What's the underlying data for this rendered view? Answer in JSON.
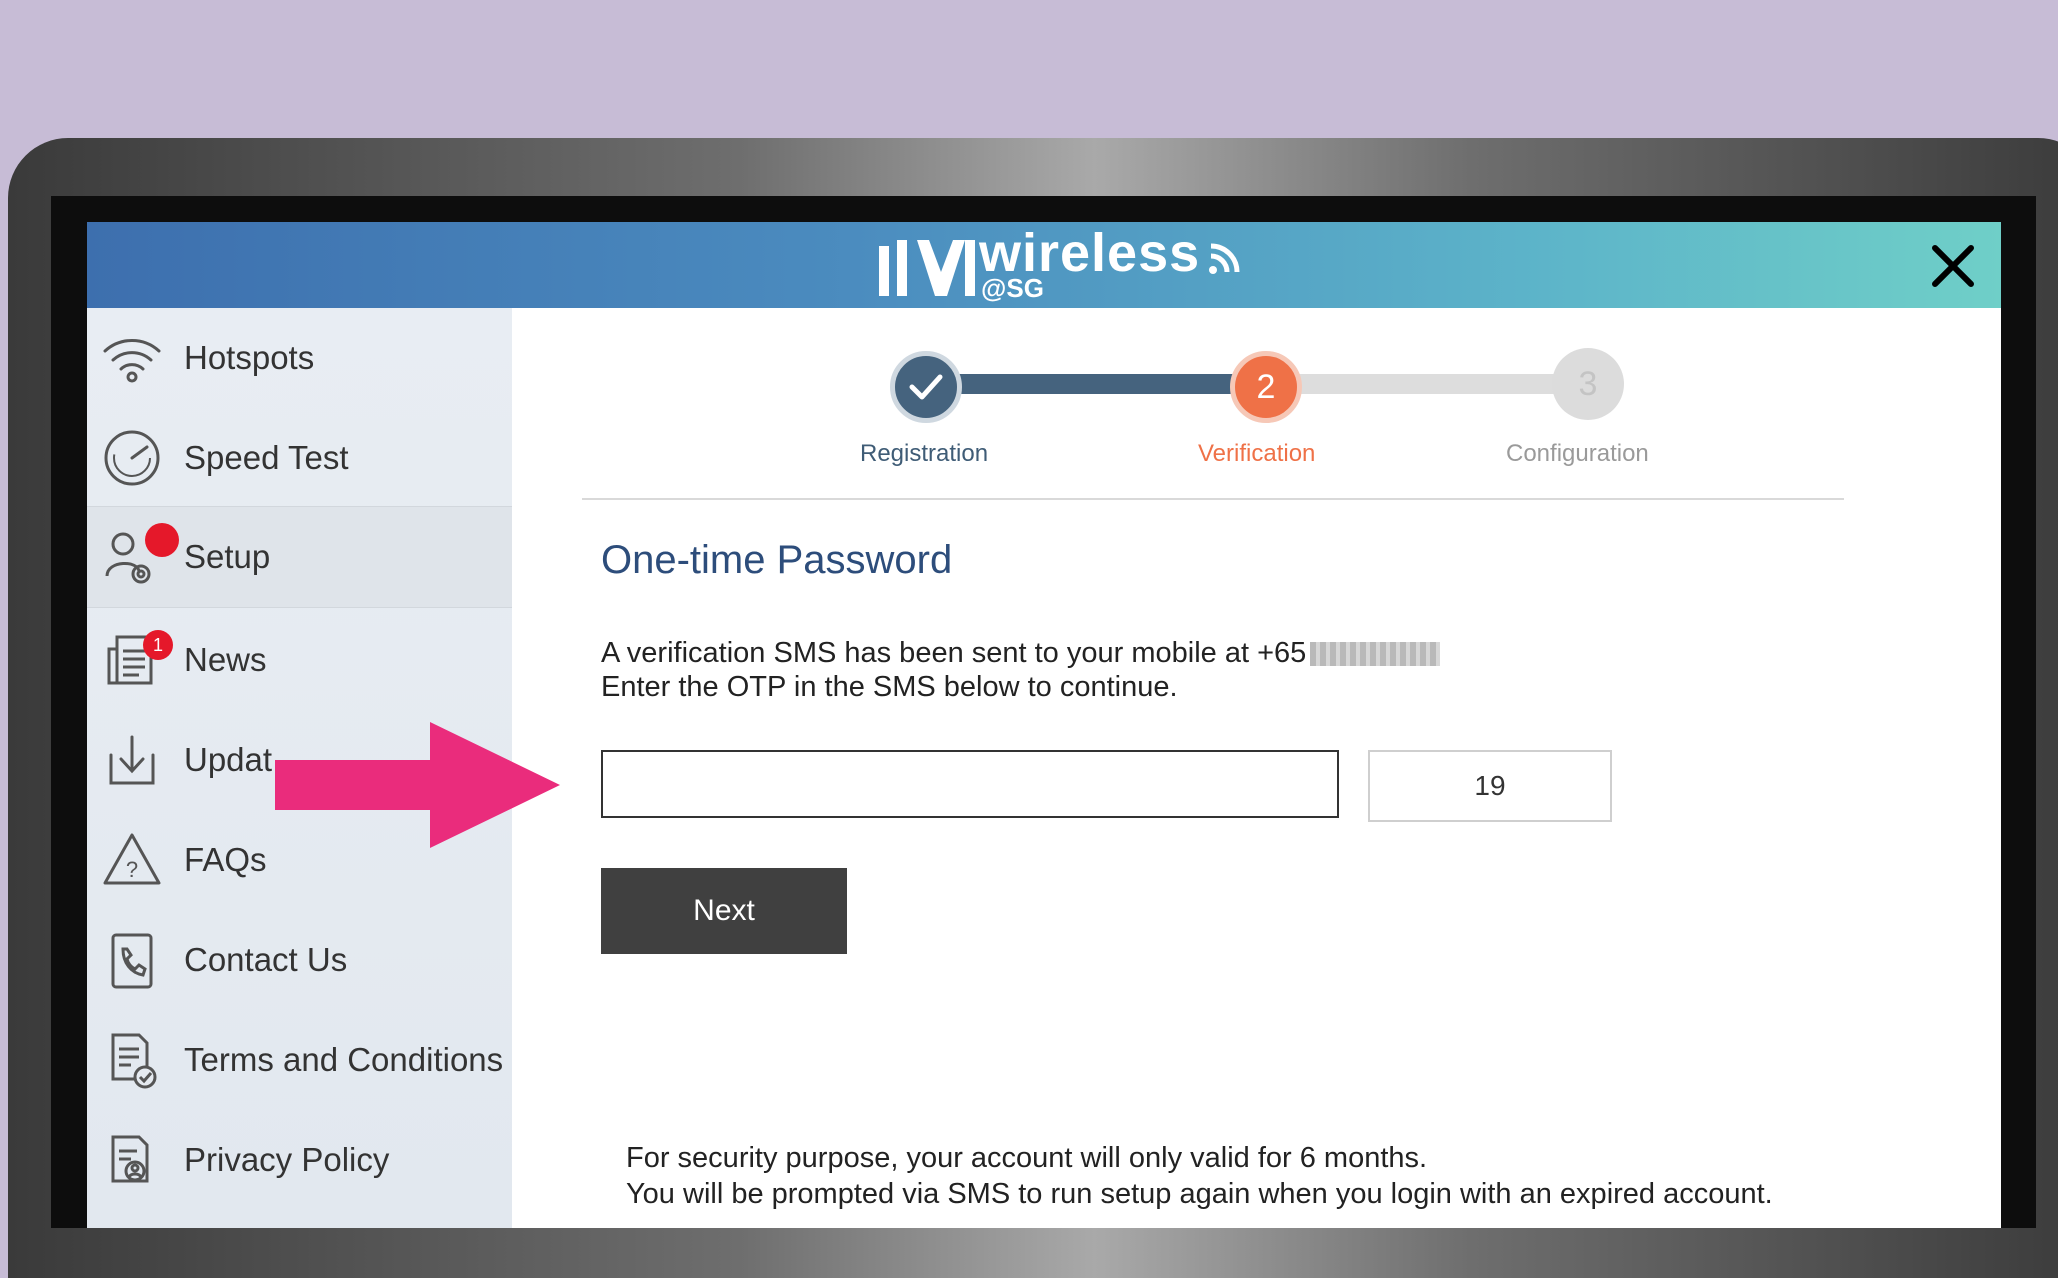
{
  "header": {
    "brand": "wireless",
    "brand_sub": "@SG"
  },
  "sidebar": {
    "items": [
      {
        "label": "Hotspots",
        "icon": "wifi-icon"
      },
      {
        "label": "Speed Test",
        "icon": "speedometer-icon"
      },
      {
        "label": "Setup",
        "icon": "user-settings-icon",
        "active": true,
        "badge": ""
      },
      {
        "label": "News",
        "icon": "news-icon",
        "badge": "1"
      },
      {
        "label": "Updat",
        "icon": "download-icon"
      },
      {
        "label": "FAQs",
        "icon": "warning-question-icon"
      },
      {
        "label": "Contact Us",
        "icon": "phone-icon"
      },
      {
        "label": "Terms and Conditions",
        "icon": "document-check-icon"
      },
      {
        "label": "Privacy Policy",
        "icon": "privacy-document-icon"
      }
    ]
  },
  "stepper": {
    "steps": [
      {
        "number": "1",
        "label": "Registration",
        "state": "done"
      },
      {
        "number": "2",
        "label": "Verification",
        "state": "current"
      },
      {
        "number": "3",
        "label": "Configuration",
        "state": "pending"
      }
    ]
  },
  "otp": {
    "title": "One-time Password",
    "line1": "A verification SMS has been sent to your mobile at +65",
    "line2": "Enter the OTP in the SMS below to continue.",
    "input_value": "",
    "timer": "19",
    "next_label": "Next"
  },
  "security": {
    "line1": "For security purpose, your account will only valid for 6 months.",
    "line2": "You will be prompted via SMS to run setup again when you login with an expired account."
  },
  "colors": {
    "accent_done": "#45637e",
    "accent_current": "#ef7147",
    "highlight_arrow": "#ea2c7c",
    "badge": "#e5182a"
  }
}
